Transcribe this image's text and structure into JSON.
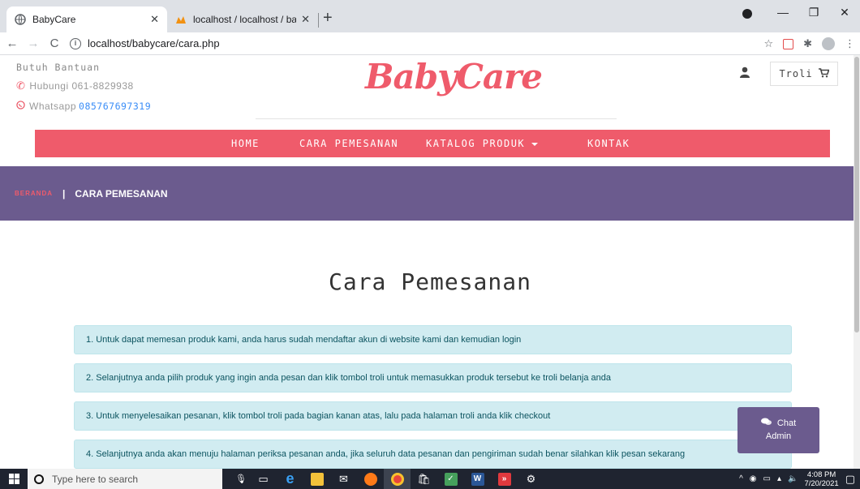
{
  "browser": {
    "tabs": [
      {
        "title": "BabyCare",
        "active": true
      },
      {
        "title": "localhost / localhost / babycare /",
        "active": false
      }
    ],
    "url": "localhost/babycare/cara.php"
  },
  "header": {
    "help_title": "Butuh Bantuan",
    "phone_label": "Hubungi 061-8829938",
    "whatsapp_label": "Whatsapp",
    "whatsapp_number": "085767697319",
    "logo": "BabyCare",
    "cart_label": "Troli"
  },
  "nav": {
    "items": [
      "HOME",
      "CARA PEMESANAN",
      "KATALOG PRODUK",
      "KONTAK"
    ]
  },
  "breadcrumb": {
    "home": "BERANDA",
    "separator": "|",
    "current": "CARA PEMESANAN"
  },
  "main": {
    "heading": "Cara Pemesanan",
    "steps": [
      "1. Untuk dapat memesan produk kami, anda harus sudah mendaftar akun di website kami dan kemudian login",
      "2. Selanjutnya anda pilih produk yang ingin anda pesan dan klik tombol troli untuk memasukkan produk tersebut ke troli belanja anda",
      "3. Untuk menyelesaikan pesanan, klik tombol troli pada bagian kanan atas, lalu pada halaman troli anda klik checkout",
      "4. Selanjutnya anda akan menuju halaman periksa pesanan anda, jika seluruh data pesanan dan pengiriman sudah benar silahkan klik pesan sekarang"
    ]
  },
  "chat": {
    "line1": "Chat",
    "line2": "Admin"
  },
  "taskbar": {
    "search_placeholder": "Type here to search",
    "time": "4:08 PM",
    "date": "7/20/2021"
  },
  "colors": {
    "accent": "#ef5b6b",
    "purple": "#6b5b8e",
    "step_bg": "#d1ecf1"
  }
}
